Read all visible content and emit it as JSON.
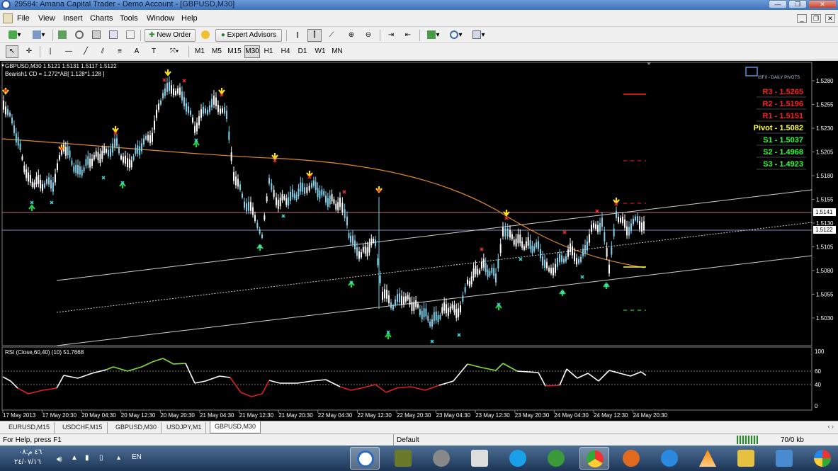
{
  "window": {
    "title": "29584: Amana Capital Trader - Demo Account - [GBPUSD,M30]",
    "buttons": {
      "minimize": "—",
      "restore": "❐",
      "close": "✕"
    }
  },
  "menu": [
    "File",
    "View",
    "Insert",
    "Charts",
    "Tools",
    "Window",
    "Help"
  ],
  "toolbar": {
    "new_order": "New Order",
    "expert_advisors": "Expert Advisors",
    "timeframes": [
      "M1",
      "M5",
      "M15",
      "M30",
      "H1",
      "H4",
      "D1",
      "W1",
      "MN"
    ],
    "active_timeframe": "M30"
  },
  "chart": {
    "symbol_line": "GBPUSD,M30  1.5121 1.5131 1.5117 1.5122",
    "indicator_line": "Bearish1 CD = 1.272*AB[ 1.128*1.128 ]",
    "pivot_panel": {
      "title": "ISFX - DAILY PIVOTS",
      "rows": [
        {
          "label": "R3 - 1.5265",
          "color": "#ff2020"
        },
        {
          "label": "R2 - 1.5196",
          "color": "#ff2020"
        },
        {
          "label": "R1 - 1.5151",
          "color": "#ff2020"
        },
        {
          "label": "Pivot - 1.5082",
          "color": "#ffff40"
        },
        {
          "label": "S1 - 1.5037",
          "color": "#30ff30"
        },
        {
          "label": "S2 - 1.4968",
          "color": "#30ff30"
        },
        {
          "label": "S3 - 1.4923",
          "color": "#30ff30"
        }
      ]
    },
    "price_axis": [
      "1.5280",
      "1.5255",
      "1.5230",
      "1.5205",
      "1.5180",
      "1.5155",
      "1.5130",
      "1.5105",
      "1.5080",
      "1.5055",
      "1.5030"
    ],
    "price_tags": [
      "1.5141",
      "1.5122"
    ],
    "rsi_label": "RSI (Close,60,40) (10) 51.7668",
    "rsi_axis": [
      "100",
      "60",
      "40",
      "0"
    ],
    "time_axis": [
      "17 May 2013",
      "17 May 20:30",
      "20 May 04:30",
      "20 May 12:30",
      "20 May 20:30",
      "21 May 04:30",
      "21 May 12:30",
      "21 May 20:30",
      "22 May 04:30",
      "22 May 12:30",
      "22 May 20:30",
      "23 May 04:30",
      "23 May 12:30",
      "23 May 20:30",
      "24 May 04:30",
      "24 May 12:30",
      "24 May 20:30"
    ]
  },
  "tabs": [
    "EURUSD,M15",
    "USDCHF,M15",
    "GBPUSD,M30",
    "USDJPY,M1",
    "GBPUSD,M30"
  ],
  "active_tab_index": 4,
  "status": {
    "help": "For Help, press F1",
    "profile": "Default",
    "traffic": "70/0 kb"
  },
  "taskbar": {
    "time": "۰۸:٤٦ م",
    "date": "٢٤/٠٧/١٦",
    "lang": "EN"
  },
  "colors": {
    "bull_candle": "#7fd0e8",
    "ma_line": "#e08a2a",
    "rsi_up": "#80e040",
    "rsi_down": "#e02020",
    "arrow_up": "#20d040",
    "arrow_down": "#ffe020"
  }
}
